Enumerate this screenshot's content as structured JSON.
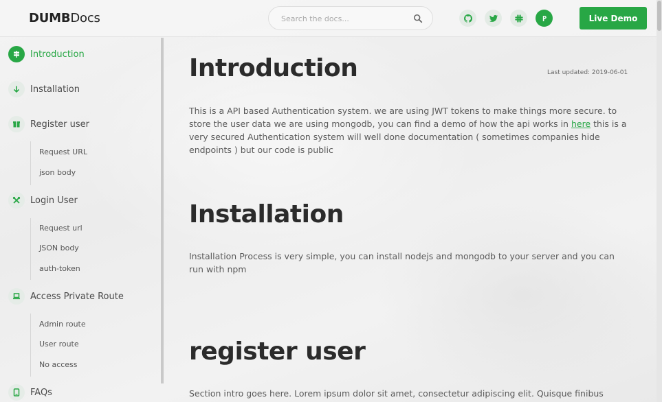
{
  "brand": {
    "bold": "DUMB",
    "light": "Docs"
  },
  "search": {
    "placeholder": "Search the docs..."
  },
  "header": {
    "social": [
      {
        "icon": "github-icon"
      },
      {
        "icon": "twitter-icon"
      },
      {
        "icon": "slack-icon"
      },
      {
        "icon": "product-hunt-icon"
      }
    ],
    "demo_label": "Live Demo"
  },
  "colors": {
    "accent": "#28a745",
    "text": "#5a5a5a",
    "heading": "#2b2b2b"
  },
  "sidebar": {
    "items": [
      {
        "label": "Introduction",
        "icon": "signpost-icon",
        "active": true
      },
      {
        "label": "Installation",
        "icon": "arrow-down-icon"
      },
      {
        "label": "Register user",
        "icon": "box-icon",
        "children": [
          "Request URL",
          "json body"
        ]
      },
      {
        "label": "Login User",
        "icon": "tools-icon",
        "children": [
          "Request url",
          "JSON body",
          "auth-token"
        ]
      },
      {
        "label": "Access Private Route",
        "icon": "laptop-icon",
        "children": [
          "Admin route",
          "User route",
          "No access"
        ]
      },
      {
        "label": "FAQs",
        "icon": "tablet-icon"
      }
    ]
  },
  "main": {
    "last_updated": "Last updated: 2019-06-01",
    "sections": [
      {
        "title": "Introduction",
        "text_before_link": "This is a API based Authentication system. we are using JWT tokens to make things more secure. to store the user data we are using mongodb, you can find a demo of how the api works in ",
        "link": "here",
        "text_after_link": " this is a very secured Authentication system will well done documentation ( sometimes companies hide endpoints ) but our code is public"
      },
      {
        "title": "Installation",
        "text": "Installation Process is very simple, you can install nodejs and mongodb to your server and you can run with npm"
      },
      {
        "title": "register user",
        "text": "Section intro goes here. Lorem ipsum dolor sit amet, consectetur adipiscing elit. Quisque finibus"
      }
    ]
  }
}
